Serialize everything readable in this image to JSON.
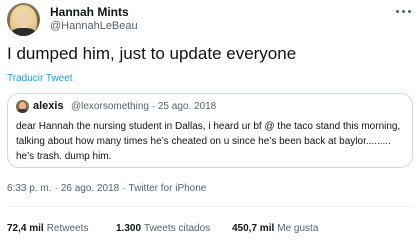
{
  "author": {
    "name": "Hannah Mints",
    "handle": "@HannahLeBeau"
  },
  "tweet": {
    "text": "I dumped him, just to update everyone",
    "translate_label": "Traducir Tweet"
  },
  "quoted_tweet": {
    "name": "alexis",
    "meta": "@lexorsomething · 25 ago. 2018",
    "text": "dear Hannah the nursing student in Dallas, i heard ur bf @ the taco stand this morning, talking about how many times he’s cheated on u since he’s been back at baylor......... he’s trash. dump him."
  },
  "timestamp": {
    "time": "6:33 p. m.",
    "date": "26 ago. 2018",
    "source": "Twitter for iPhone"
  },
  "stats": {
    "retweets_count": "72,4 mil",
    "retweets_label": "Retweets",
    "quotes_count": "1.300",
    "quotes_label": "Tweets citados",
    "likes_count": "450,7 mil",
    "likes_label": "Me gusta"
  },
  "icons": [
    "avatar",
    "more-options-icon",
    "quoted-avatar"
  ],
  "colors": {
    "text": "#0f1419",
    "secondary": "#536471",
    "link": "#1d9bf0",
    "border": "#cfd9de"
  }
}
